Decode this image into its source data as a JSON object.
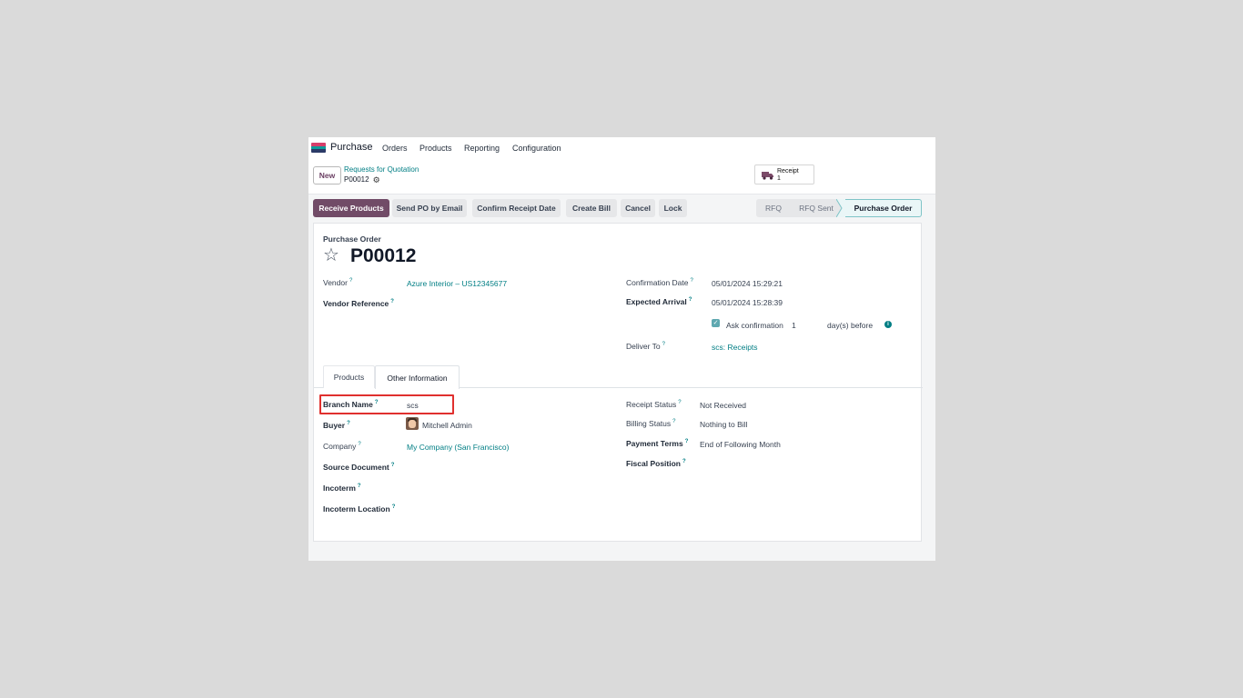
{
  "topnav": {
    "app_name": "Purchase",
    "items": [
      "Orders",
      "Products",
      "Reporting",
      "Configuration"
    ]
  },
  "control": {
    "new_label": "New",
    "breadcrumb_parent": "Requests for Quotation",
    "breadcrumb_current": "P00012",
    "smart_button": {
      "label": "Receipt",
      "count": "1"
    }
  },
  "actions": [
    "Receive Products",
    "Send PO by Email",
    "Confirm Receipt Date",
    "Create Bill",
    "Cancel",
    "Lock"
  ],
  "stages": {
    "items": [
      "RFQ",
      "RFQ Sent",
      "Purchase Order"
    ],
    "current": "Purchase Order"
  },
  "form": {
    "type_label": "Purchase Order",
    "name": "P00012",
    "vendor_label": "Vendor",
    "vendor_value": "Azure Interior – US12345677",
    "vendor_ref_label": "Vendor Reference",
    "confirmation_date_label": "Confirmation Date",
    "confirmation_date_value": "05/01/2024 15:29:21",
    "expected_arrival_label": "Expected Arrival",
    "expected_arrival_value": "05/01/2024 15:28:39",
    "ask_confirmation_label": "Ask confirmation",
    "ask_confirmation_days": "1",
    "ask_confirmation_suffix": "day(s) before",
    "deliver_to_label": "Deliver To",
    "deliver_to_value": "scs: Receipts"
  },
  "tabs": [
    "Products",
    "Other Information"
  ],
  "other_info": {
    "branch_name_label": "Branch Name",
    "branch_name_value": "scs",
    "buyer_label": "Buyer",
    "buyer_value": "Mitchell Admin",
    "company_label": "Company",
    "company_value": "My Company (San Francisco)",
    "source_document_label": "Source Document",
    "incoterm_label": "Incoterm",
    "incoterm_location_label": "Incoterm Location",
    "receipt_status_label": "Receipt Status",
    "receipt_status_value": "Not Received",
    "billing_status_label": "Billing Status",
    "billing_status_value": "Nothing to Bill",
    "payment_terms_label": "Payment Terms",
    "payment_terms_value": "End of Following Month",
    "fiscal_position_label": "Fiscal Position"
  },
  "help_marker": "?",
  "colors": {
    "primary": "#714b67",
    "link": "#017e84",
    "highlight": "#e0302e"
  }
}
